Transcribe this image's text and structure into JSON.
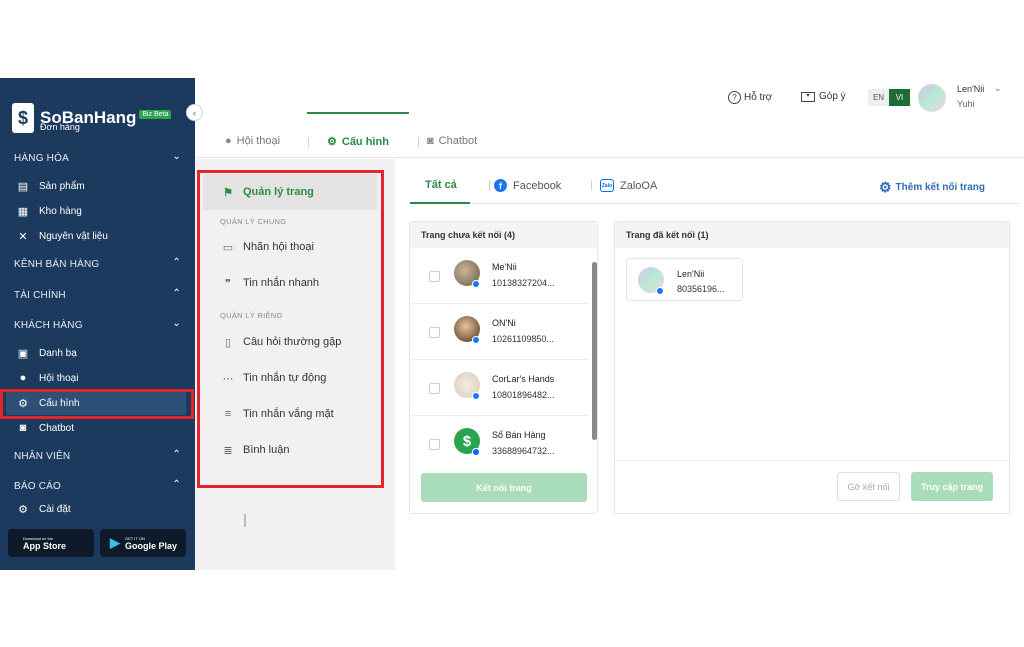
{
  "brand": {
    "name": "SoBanHang",
    "badge": "Biz Beta"
  },
  "sidebar": {
    "partial_item": "Đơn hàng",
    "sections": [
      {
        "label": "HÀNG HÓA",
        "chev": "⌄"
      },
      {
        "label": "KÊNH BÁN HÀNG",
        "chev": "⌃"
      },
      {
        "label": "TÀI CHÍNH",
        "chev": "⌃"
      },
      {
        "label": "KHÁCH HÀNG",
        "chev": "⌄"
      },
      {
        "label": "NHÂN VIÊN",
        "chev": "⌃"
      },
      {
        "label": "BÁO CÁO",
        "chev": "⌃"
      }
    ],
    "items": [
      {
        "label": "Sản phẩm",
        "icon": "box-icon"
      },
      {
        "label": "Kho hàng",
        "icon": "warehouse-icon"
      },
      {
        "label": "Nguyên vật liệu",
        "icon": "tools-icon"
      },
      {
        "label": "Danh bạ",
        "icon": "contacts-icon"
      },
      {
        "label": "Hội thoại",
        "icon": "chat-icon"
      },
      {
        "label": "Cấu hình",
        "icon": "gear-icon"
      },
      {
        "label": "Chatbot",
        "icon": "robot-icon"
      },
      {
        "label": "Cài đặt",
        "icon": "gear-icon"
      }
    ],
    "stores": {
      "appstore_small": "Download on the",
      "appstore": "App Store",
      "google_small": "GET IT ON",
      "google": "Google Play"
    }
  },
  "topbar": {
    "help": "Hỗ trợ",
    "feedback": "Góp ý",
    "lang_en": "EN",
    "lang_vi": "VI",
    "user_name": "Len'Nii",
    "user_sub": "Yuhi"
  },
  "main_tabs": [
    {
      "label": "Hội thoại"
    },
    {
      "label": "Cấu hình"
    },
    {
      "label": "Chatbot"
    }
  ],
  "settings_menu": {
    "active": "Quản lý trang",
    "group1": "QUẢN LÝ CHUNG",
    "group2": "QUẢN LÝ RIÊNG",
    "items": [
      "Nhãn hội thoại",
      "Tin nhắn nhanh",
      "Câu hỏi thường gặp",
      "Tin nhắn tự động",
      "Tin nhắn vắng mặt",
      "Bình luận"
    ]
  },
  "channel_tabs": [
    {
      "label": "Tất cả"
    },
    {
      "label": "Facebook"
    },
    {
      "label": "ZaloOA"
    }
  ],
  "add_connection": "Thêm kết nối trang",
  "unconnected": {
    "title": "Trang chưa kết nối (4)",
    "pages": [
      {
        "name": "Me'Nii",
        "id": "10138327204..."
      },
      {
        "name": "ON'Ni",
        "id": "10261109850..."
      },
      {
        "name": "CorLar's Hands",
        "id": "10801896482..."
      },
      {
        "name": "Sổ Bán Hàng",
        "id": "33688964732..."
      }
    ],
    "connect_button": "Kết nối trang"
  },
  "connected": {
    "title": "Trang đã kết nối (1)",
    "pages": [
      {
        "name": "Len'Nii",
        "id": "80356196..."
      }
    ],
    "disconnect_button": "Gỡ kết nối",
    "visit_button": "Truy cập trang"
  },
  "colors": {
    "sidebar": "#1c3a5e",
    "accent": "#2d8a46",
    "highlight": "#e4262c",
    "link": "#2e6db4"
  }
}
